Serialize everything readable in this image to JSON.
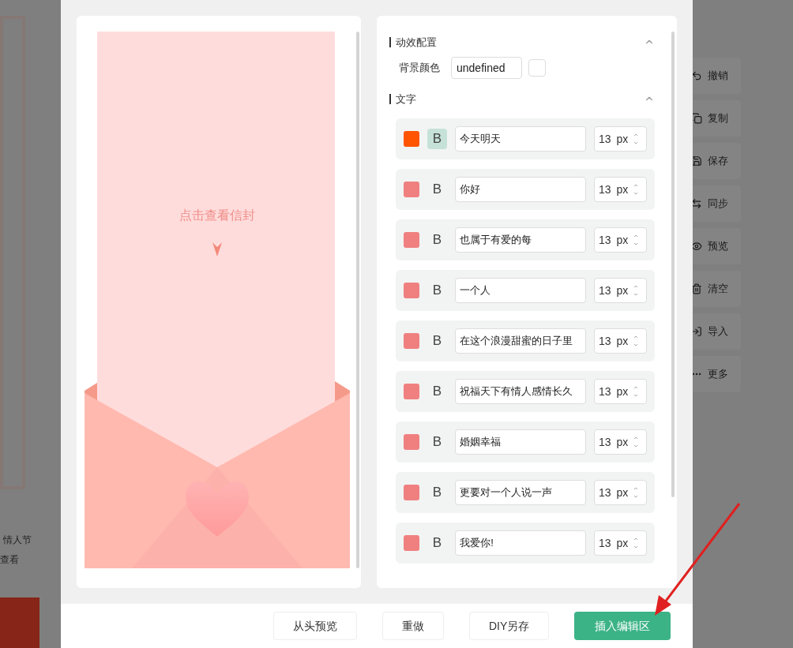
{
  "background": {
    "tag_text": "情人节",
    "link_text": "查看",
    "toolbar": [
      {
        "label": "撤销",
        "kind": "undo"
      },
      {
        "label": "复制",
        "kind": "copy"
      },
      {
        "label": "保存",
        "kind": "save"
      },
      {
        "label": "同步",
        "kind": "sync"
      },
      {
        "label": "预览",
        "kind": "preview"
      },
      {
        "label": "清空",
        "kind": "clear"
      },
      {
        "label": "导入",
        "kind": "import"
      },
      {
        "label": "更多",
        "kind": "more"
      }
    ]
  },
  "preview": {
    "letter_text": "点击查看信封"
  },
  "animation_section": {
    "title": "动效配置",
    "expanded": true,
    "bg_label": "背景颜色",
    "bg_value": "undefined"
  },
  "text_section": {
    "title": "文字",
    "expanded": true,
    "items": [
      {
        "color": "#ff5500",
        "bold_label": "B",
        "bold": true,
        "text": "今天明天",
        "size": "13",
        "unit": "px"
      },
      {
        "color": "#f08080",
        "bold_label": "B",
        "bold": false,
        "text": "你好",
        "size": "13",
        "unit": "px"
      },
      {
        "color": "#f08080",
        "bold_label": "B",
        "bold": false,
        "text": "也属于有爱的每",
        "size": "13",
        "unit": "px"
      },
      {
        "color": "#f08080",
        "bold_label": "B",
        "bold": false,
        "text": "一个人",
        "size": "13",
        "unit": "px"
      },
      {
        "color": "#f08080",
        "bold_label": "B",
        "bold": false,
        "text": "在这个浪漫甜蜜的日子里",
        "size": "13",
        "unit": "px"
      },
      {
        "color": "#f08080",
        "bold_label": "B",
        "bold": false,
        "text": "祝福天下有情人感情长久",
        "size": "13",
        "unit": "px"
      },
      {
        "color": "#f08080",
        "bold_label": "B",
        "bold": false,
        "text": "婚姻幸福",
        "size": "13",
        "unit": "px"
      },
      {
        "color": "#f08080",
        "bold_label": "B",
        "bold": false,
        "text": "更要对一个人说一声",
        "size": "13",
        "unit": "px"
      },
      {
        "color": "#f08080",
        "bold_label": "B",
        "bold": false,
        "text": "我爱你!",
        "size": "13",
        "unit": "px"
      }
    ]
  },
  "footer_buttons": [
    {
      "label": "从头预览",
      "kind": "default"
    },
    {
      "label": "重做",
      "kind": "default"
    },
    {
      "label": "DIY另存",
      "kind": "default"
    },
    {
      "label": "插入编辑区",
      "kind": "primary"
    }
  ]
}
